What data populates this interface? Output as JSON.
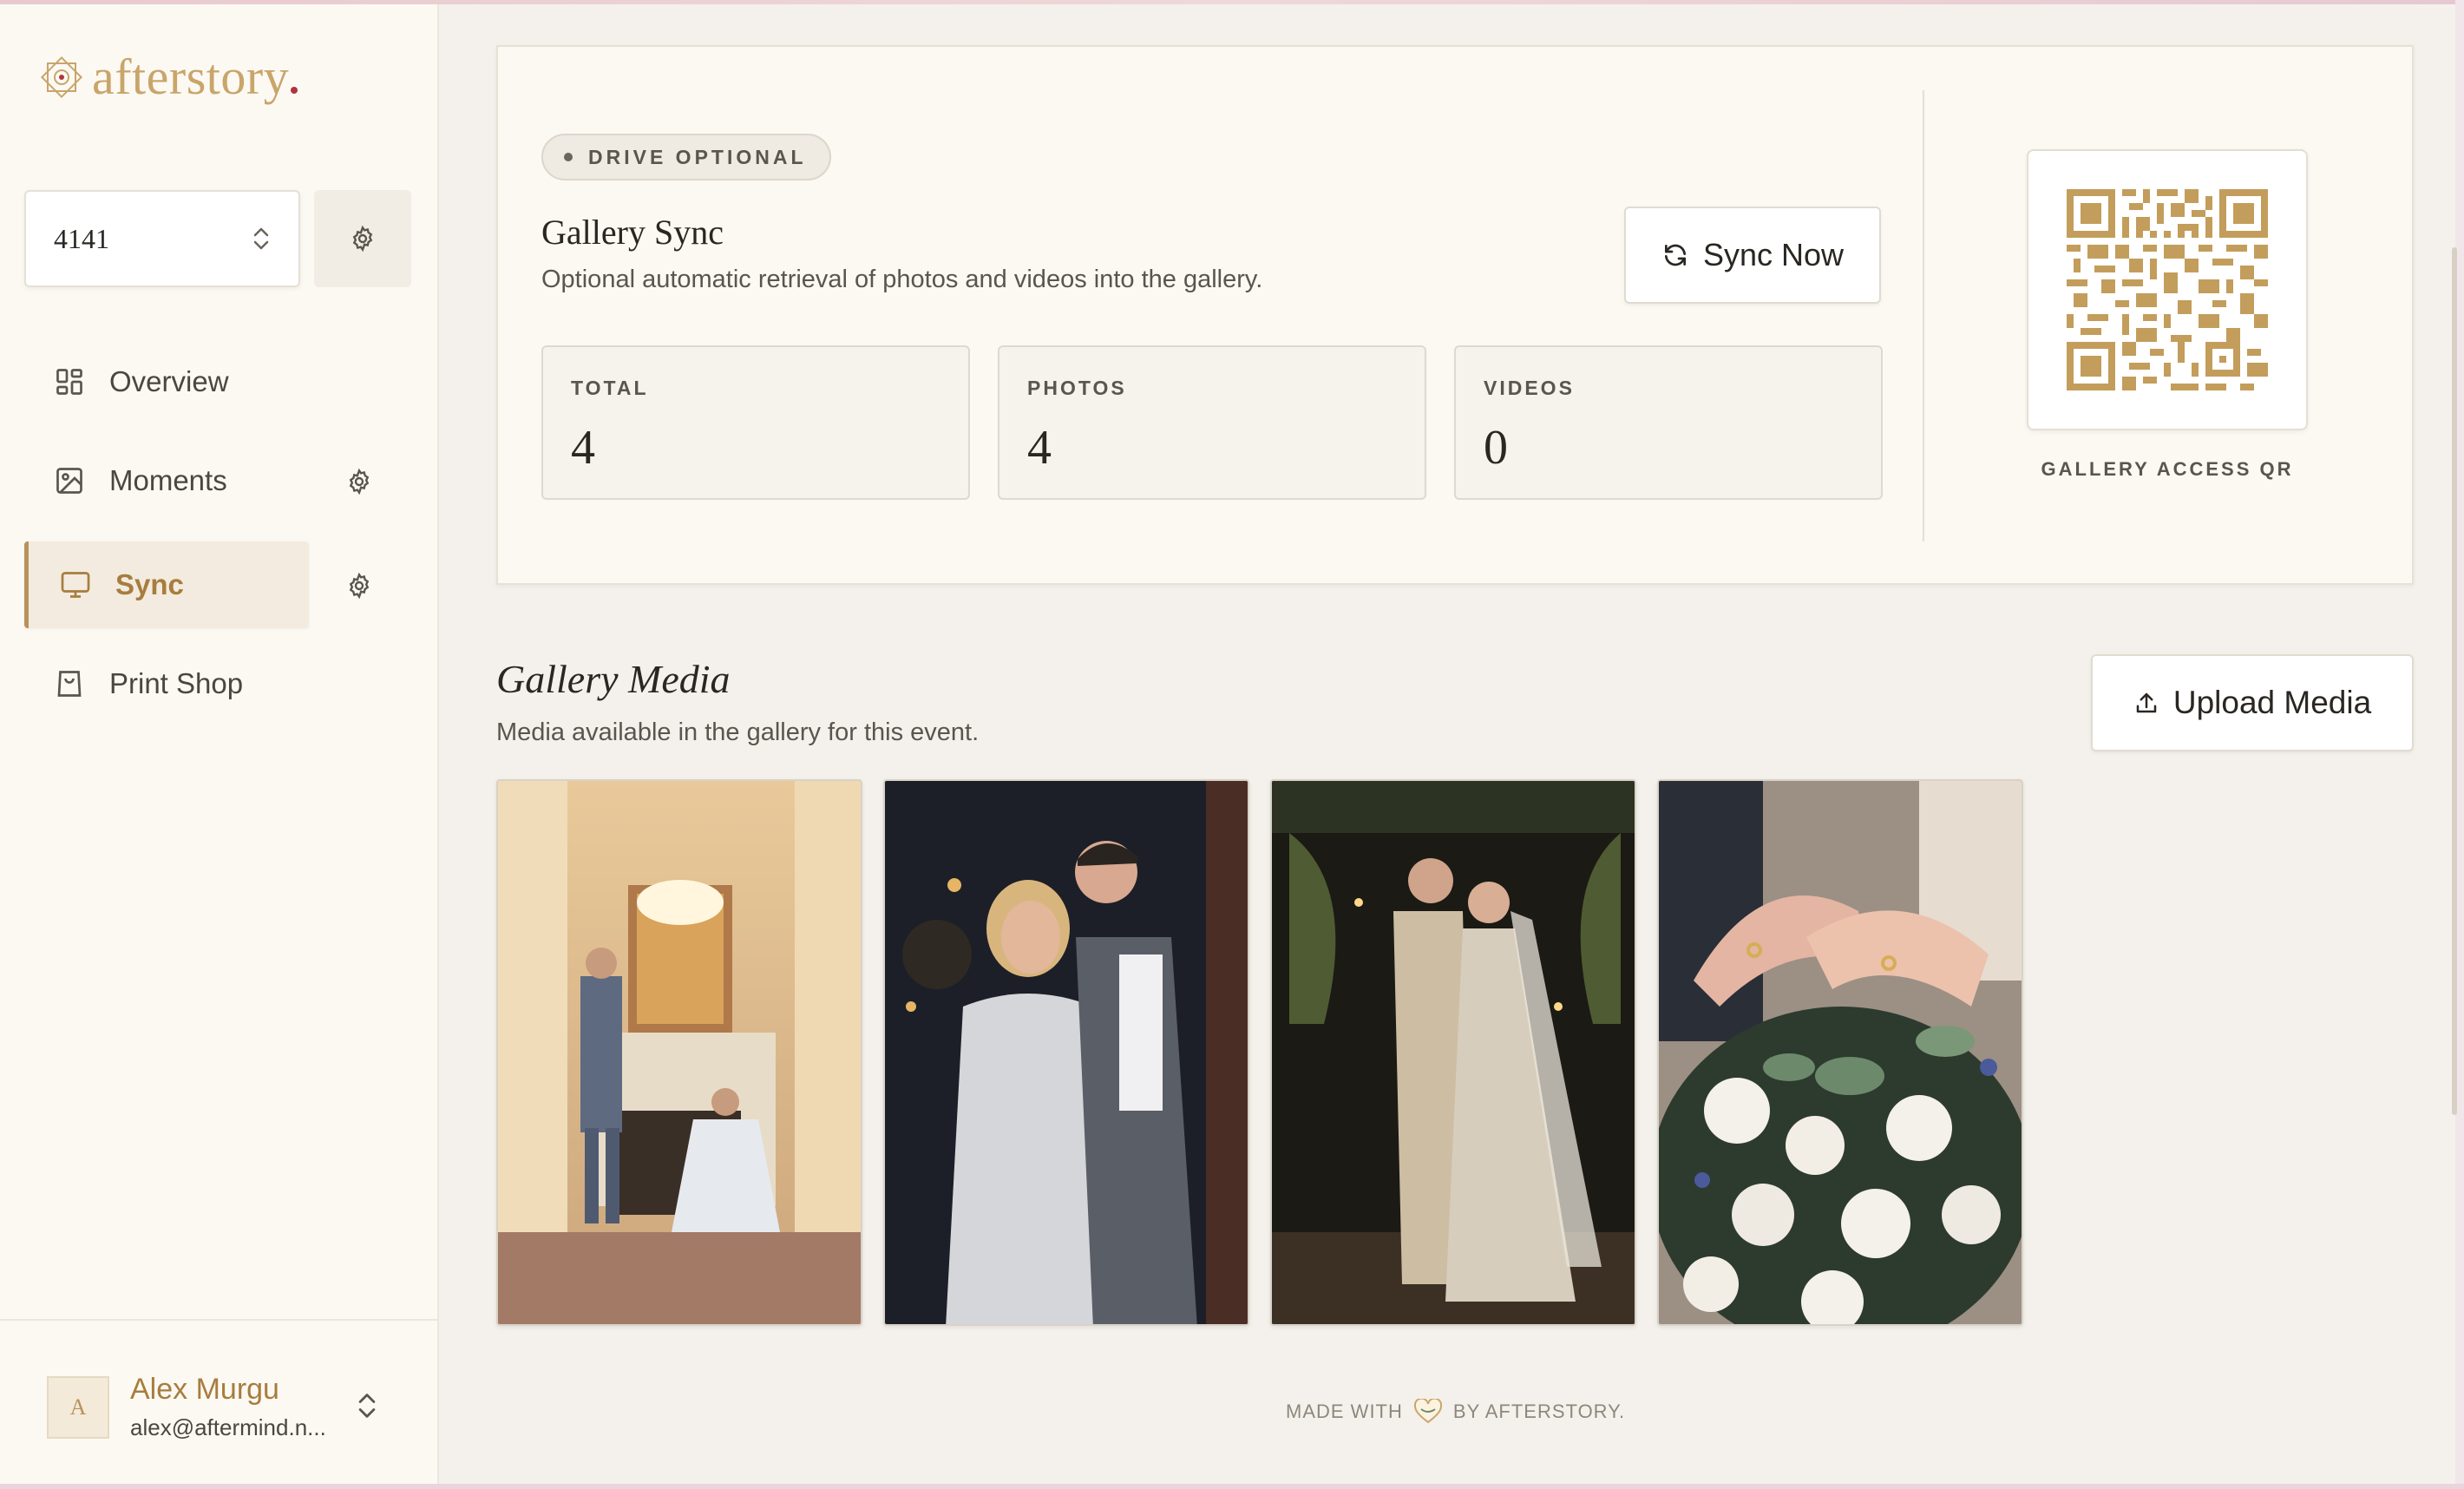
{
  "brand": {
    "name": "afterstory",
    "accent": "#c9a56a",
    "dot_color": "#b0343f"
  },
  "event_selector": {
    "value": "4141"
  },
  "nav": {
    "items": [
      {
        "label": "Overview",
        "icon": "grid-icon"
      },
      {
        "label": "Moments",
        "icon": "image-icon",
        "has_settings": true
      },
      {
        "label": "Sync",
        "icon": "monitor-icon",
        "has_settings": true,
        "active": true
      },
      {
        "label": "Print Shop",
        "icon": "shopping-bag-icon"
      }
    ]
  },
  "user": {
    "initial": "A",
    "name": "Alex Murgu",
    "email": "alex@aftermind.n..."
  },
  "sync": {
    "badge": "DRIVE OPTIONAL",
    "title": "Gallery Sync",
    "subtitle": "Optional automatic retrieval of photos and videos into the gallery.",
    "button": "Sync Now",
    "stats": [
      {
        "label": "TOTAL",
        "value": "4"
      },
      {
        "label": "PHOTOS",
        "value": "4"
      },
      {
        "label": "VIDEOS",
        "value": "0"
      }
    ],
    "qr_label": "GALLERY ACCESS QR"
  },
  "gallery": {
    "title": "Gallery Media",
    "subtitle": "Media available in the gallery for this event.",
    "upload_button": "Upload Media",
    "items": [
      {
        "alt": "couple by fireplace"
      },
      {
        "alt": "couple embracing"
      },
      {
        "alt": "couple dancing"
      },
      {
        "alt": "hands with rings on bouquet"
      }
    ]
  },
  "footer": {
    "left": "MADE WITH",
    "right": "BY AFTERSTORY."
  }
}
